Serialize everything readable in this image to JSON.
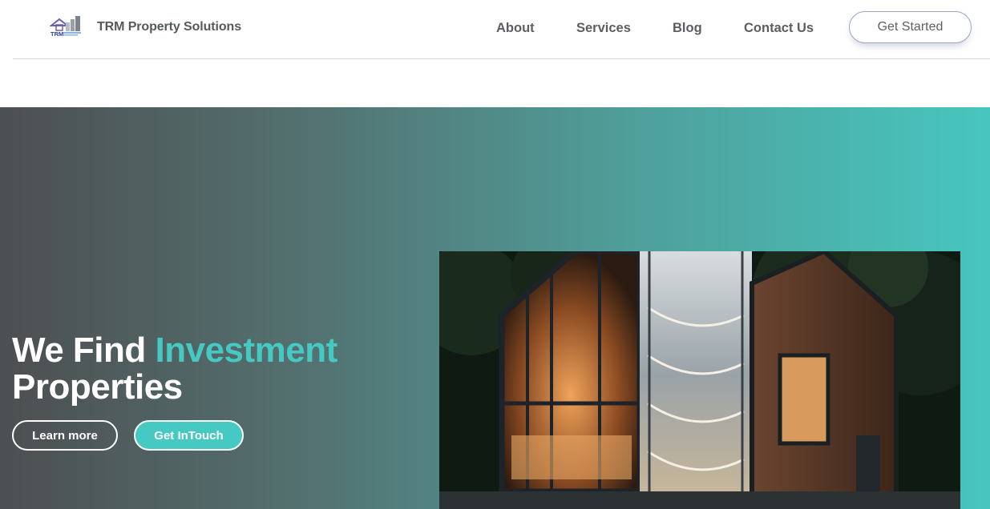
{
  "header": {
    "brand": "TRM Property Solutions",
    "logo_text": "TRM",
    "nav": [
      "About",
      "Services",
      "Blog",
      "Contact Us"
    ],
    "cta_label": "Get Started"
  },
  "hero": {
    "title_part1": "We Find ",
    "title_accent": "Investment",
    "title_part2": "Properties",
    "buttons": {
      "learn_more": "Learn more",
      "get_in_touch": "Get InTouch"
    },
    "image_alt": "house-photo"
  },
  "colors": {
    "accent": "#46c9c2",
    "gradient_start": "#4d4f51",
    "gradient_end": "#47c6bf",
    "nav_text": "#5b5f63"
  }
}
